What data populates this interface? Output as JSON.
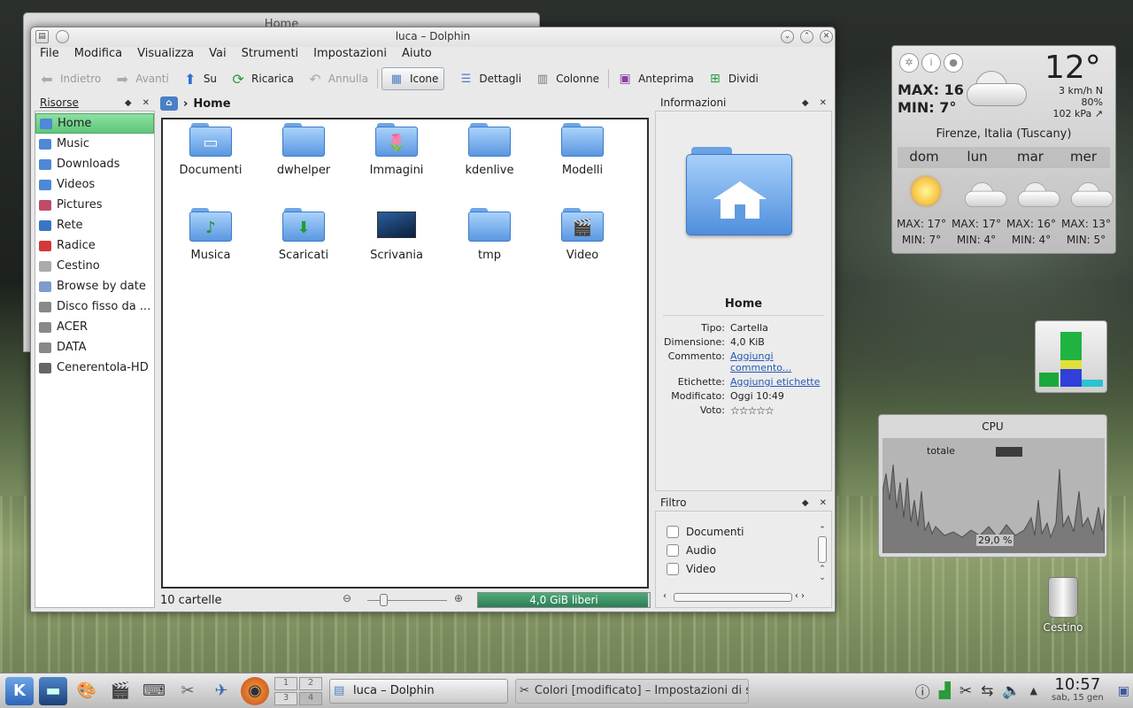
{
  "back_window": {
    "title": "Home"
  },
  "window": {
    "title": "luca – Dolphin"
  },
  "menu": [
    "File",
    "Modifica",
    "Visualizza",
    "Vai",
    "Strumenti",
    "Impostazioni",
    "Aiuto"
  ],
  "toolbar": {
    "back": "Indietro",
    "forward": "Avanti",
    "up": "Su",
    "reload": "Ricarica",
    "undo": "Annulla",
    "icons": "Icone",
    "details": "Dettagli",
    "columns": "Colonne",
    "preview": "Anteprima",
    "split": "Dividi"
  },
  "places": {
    "title": "Risorse",
    "items": [
      {
        "label": "Home",
        "color": "#4e88d6"
      },
      {
        "label": "Music",
        "color": "#4e88d6"
      },
      {
        "label": "Downloads",
        "color": "#4e88d6"
      },
      {
        "label": "Videos",
        "color": "#4e88d6"
      },
      {
        "label": "Pictures",
        "color": "#c04a6a"
      },
      {
        "label": "Rete",
        "color": "#3a74c7"
      },
      {
        "label": "Radice",
        "color": "#d23a3a"
      },
      {
        "label": "Cestino",
        "color": "#aaaaaa"
      },
      {
        "label": "Browse by date",
        "color": "#7b9ccc"
      },
      {
        "label": "Disco fisso da ...",
        "color": "#888888"
      },
      {
        "label": "ACER",
        "color": "#888888"
      },
      {
        "label": "DATA",
        "color": "#888888"
      },
      {
        "label": "Cenerentola-HD",
        "color": "#666666"
      }
    ]
  },
  "breadcrumb": {
    "location": "Home"
  },
  "files": [
    {
      "name": "Documenti",
      "icon": "documents-folder-icon"
    },
    {
      "name": "dwhelper",
      "icon": "folder-icon"
    },
    {
      "name": "Immagini",
      "icon": "pictures-folder-icon"
    },
    {
      "name": "kdenlive",
      "icon": "folder-icon"
    },
    {
      "name": "Modelli",
      "icon": "folder-icon"
    },
    {
      "name": "Musica",
      "icon": "music-folder-icon"
    },
    {
      "name": "Scaricati",
      "icon": "downloads-folder-icon"
    },
    {
      "name": "Scrivania",
      "icon": "desktop-folder-icon"
    },
    {
      "name": "tmp",
      "icon": "folder-icon"
    },
    {
      "name": "Video",
      "icon": "video-folder-icon"
    }
  ],
  "status": {
    "count": "10 cartelle",
    "free": "4,0 GiB liberi",
    "free_fraction": 0.99
  },
  "info": {
    "title": "Informazioni",
    "name": "Home",
    "rows": {
      "tipo_k": "Tipo:",
      "tipo_v": "Cartella",
      "dim_k": "Dimensione:",
      "dim_v": "4,0 KiB",
      "comm_k": "Commento:",
      "comm_v": "Aggiungi commento...",
      "etich_k": "Etichette:",
      "etich_v": "Aggiungi etichette",
      "mod_k": "Modificato:",
      "mod_v": "Oggi 10:49",
      "voto_k": "Voto:",
      "voto_v": 0
    }
  },
  "filter": {
    "title": "Filtro",
    "items": [
      "Documenti",
      "Audio",
      "Video"
    ]
  },
  "weather": {
    "max": "MAX: 16",
    "min": "MIN: 7°",
    "temp": "12°",
    "wind": "3 km/h N",
    "humidity": "80%",
    "pressure": "102 kPa ↗",
    "city": "Firenze, Italia (Tuscany)",
    "days": [
      {
        "day": "dom",
        "icon": "sun-icon",
        "max": "MAX: 17°",
        "min": "MIN: 7°"
      },
      {
        "day": "lun",
        "icon": "cloud-icon",
        "max": "MAX: 17°",
        "min": "MIN: 4°"
      },
      {
        "day": "mar",
        "icon": "cloud-icon",
        "max": "MAX: 16°",
        "min": "MIN: 4°"
      },
      {
        "day": "mer",
        "icon": "cloud-icon",
        "max": "MAX: 13°",
        "min": "MIN: 5°"
      }
    ]
  },
  "cpu": {
    "title": "CPU",
    "label": "totale",
    "value": "29,0 %"
  },
  "desktop": {
    "trash": "Cestino"
  },
  "taskbar": {
    "pager": [
      "1",
      "2",
      "3",
      "4"
    ],
    "tasks": [
      "luca – Dolphin",
      "Colori [modificato] – Impostazioni di si"
    ],
    "time": "10:57",
    "date": "sab, 15 gen"
  }
}
